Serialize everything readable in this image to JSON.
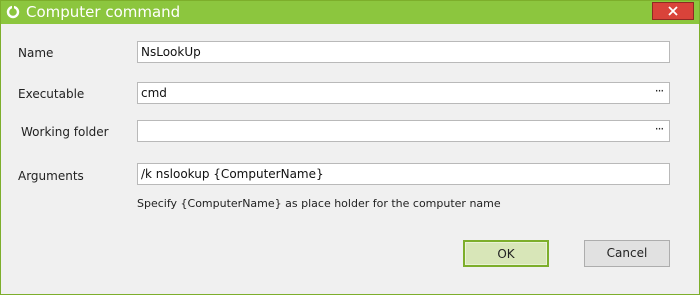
{
  "window": {
    "title": "Computer command",
    "accent_color": "#8cc63e",
    "close_color": "#d9433a"
  },
  "form": {
    "name": {
      "label": "Name",
      "value": "NsLookUp"
    },
    "executable": {
      "label": "Executable",
      "value": "cmd",
      "browse": "···"
    },
    "working_folder": {
      "label": "Working folder",
      "value": "",
      "browse": "···"
    },
    "arguments": {
      "label": "Arguments",
      "value": "/k nslookup {ComputerName}"
    },
    "hint": "Specify {ComputerName} as place holder for the computer name"
  },
  "buttons": {
    "ok": "OK",
    "cancel": "Cancel"
  },
  "icons": {
    "app": "app-ring-icon",
    "close": "close-icon"
  }
}
